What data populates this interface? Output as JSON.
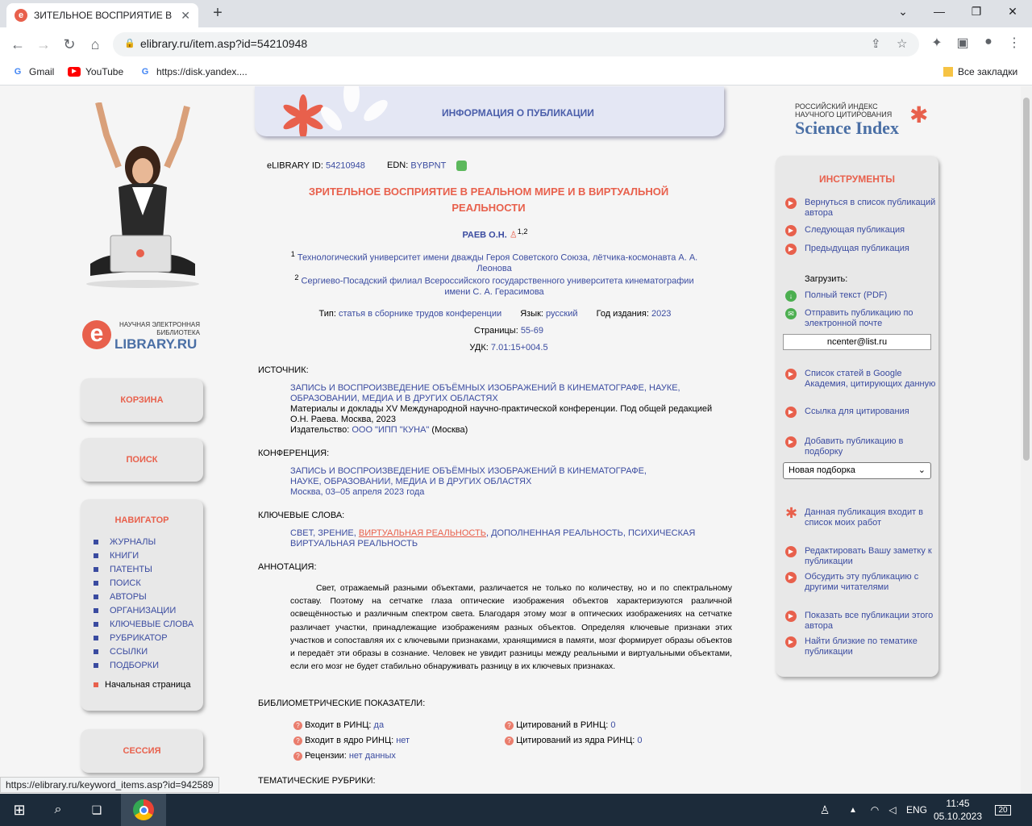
{
  "browser": {
    "tab_title": "ЗИТЕЛЬНОЕ ВОСПРИЯТИЕ В Р",
    "url": "elibrary.ru/item.asp?id=54210948",
    "bookmarks": [
      "Gmail",
      "YouTube",
      "https://disk.yandex....",
      "Все закладки"
    ]
  },
  "left": {
    "logo_line1": "НАУЧНАЯ ЭЛЕКТРОННАЯ",
    "logo_line2": "БИБЛИОТЕКА",
    "logo_name": "LIBRARY.RU",
    "logo_letter": "e",
    "cart": "КОРЗИНА",
    "search": "ПОИСК",
    "navigator": "НАВИГАТОР",
    "nav_items": [
      "ЖУРНАЛЫ",
      "КНИГИ",
      "ПАТЕНТЫ",
      "ПОИСК",
      "АВТОРЫ",
      "ОРГАНИЗАЦИИ",
      "КЛЮЧЕВЫЕ СЛОВА",
      "РУБРИКАТОР",
      "ССЫЛКИ",
      "ПОДБОРКИ"
    ],
    "home": "Начальная страница",
    "session": "СЕССИЯ"
  },
  "banner": {
    "label": "ИНФОРМАЦИЯ О ПУБЛИКАЦИИ"
  },
  "pub": {
    "id_label": "eLIBRARY ID:",
    "id": "54210948",
    "edn_label": "EDN:",
    "edn": "BYBPNT",
    "title": "ЗРИТЕЛЬНОЕ ВОСПРИЯТИЕ В РЕАЛЬНОМ МИРЕ И В ВИРТУАЛЬНОЙ РЕАЛЬНОСТИ",
    "author": "РАЕВ О.Н.",
    "author_sup": "1,2",
    "aff1": "Технологический университет имени дважды Героя Советского Союза, лётчика-космонавта А. А. Леонова",
    "aff2": "Сергиево-Посадский филиал Всероссийского государственного университета кинематографии имени С. А. Герасимова",
    "type_label": "Тип:",
    "type": "статья в сборнике трудов конференции",
    "lang_label": "Язык:",
    "lang": "русский",
    "year_label": "Год издания:",
    "year": "2023",
    "pages_label": "Страницы:",
    "pages": "55-69",
    "udk_label": "УДК:",
    "udk": "7.01:15+004.5",
    "source_h": "ИСТОЧНИК:",
    "source_title": "ЗАПИСЬ И ВОСПРОИЗВЕДЕНИЕ ОБЪЁМНЫХ ИЗОБРАЖЕНИЙ В КИНЕМАТОГРАФЕ, НАУКЕ, ОБРАЗОВАНИИ, МЕДИА И В ДРУГИХ ОБЛАСТЯХ",
    "source_desc": "Материалы и доклады XV Международной научно-практической конференции. Под общей редакцией О.Н. Раева. Москва, 2023",
    "publisher_label": "Издательство:",
    "publisher": "ООО \"ИПП \"КУНА\"",
    "publisher_city": "(Москва)",
    "conf_h": "КОНФЕРЕНЦИЯ:",
    "conf_title": "ЗАПИСЬ И ВОСПРОИЗВЕДЕНИЕ ОБЪЁМНЫХ ИЗОБРАЖЕНИЙ В КИНЕМАТОГРАФЕ, НАУКЕ, ОБРАЗОВАНИИ, МЕДИА И В ДРУГИХ ОБЛАСТЯХ",
    "conf_place": "Москва, 03–05 апреля 2023 года",
    "kw_h": "КЛЮЧЕВЫЕ СЛОВА:",
    "kw1": "СВЕТ",
    "kw2": "ЗРЕНИЕ",
    "kw3": "ВИРТУАЛЬНАЯ РЕАЛЬНОСТЬ",
    "kw4": "ДОПОЛНЕННАЯ РЕАЛЬНОСТЬ",
    "kw5": "ПСИХИЧЕСКАЯ ВИРТУАЛЬНАЯ РЕАЛЬНОСТЬ",
    "abs_h": "АННОТАЦИЯ:",
    "abstract": "Свет, отражаемый разными объектами, различается не только по количеству, но и по спектральному составу. Поэтому на сетчатке глаза оптические изображения объектов характеризуются различной освещённостью и различным спектром света. Благодаря этому мозг в оптических изображениях на сетчатке различает участки, принадлежащие изображениям разных объектов. Определяя ключевые признаки этих участков и сопоставляя их с ключевыми признаками, хранящимися в памяти, мозг формирует образы объектов и передаёт эти образы в сознание. Человек не увидит разницы между реальными и виртуальными объектами, если его мозг не будет стабильно обнаруживать разницу в их ключевых признаках.",
    "biblio_h": "БИБЛИОМЕТРИЧЕСКИЕ ПОКАЗАТЕЛИ:",
    "m1_label": "Входит в РИНЦ:",
    "m1": "да",
    "m2_label": "Входит в ядро РИНЦ:",
    "m2": "нет",
    "m3_label": "Рецензии:",
    "m3": "нет данных",
    "m4_label": "Цитирований в РИНЦ:",
    "m4": "0",
    "m5_label": "Цитирований из ядра РИНЦ:",
    "m5": "0",
    "rubrics_h": "ТЕМАТИЧЕСКИЕ РУБРИКИ:"
  },
  "right": {
    "sci_line1": "РОССИЙСКИЙ ИНДЕКС",
    "sci_line2": "НАУЧНОГО ЦИТИРОВАНИЯ",
    "sci_name": "Science Index",
    "tools": "ИНСТРУМЕНТЫ",
    "i1": "Вернуться в список публикаций автора",
    "i2": "Следующая публикация",
    "i3": "Предыдущая публикация",
    "load": "Загрузить:",
    "i4": "Полный текст (PDF)",
    "i5": "Отправить публикацию по электронной почте",
    "email": "ncenter@list.ru",
    "i6": "Список статей в Google Академия, цитирующих данную",
    "i7": "Ссылка для цитирования",
    "i8": "Добавить публикацию в подборку",
    "select": "Новая подборка",
    "i9": "Данная публикация входит в список моих работ",
    "i10": "Редактировать Вашу заметку к публикации",
    "i11": "Обсудить эту публикацию с другими читателями",
    "i12": "Показать все публикации этого автора",
    "i13": "Найти близкие по тематике публикации"
  },
  "status_url": "https://elibrary.ru/keyword_items.asp?id=942589",
  "taskbar": {
    "lang": "ENG",
    "time": "11:45",
    "date": "05.10.2023",
    "notif": "20"
  }
}
